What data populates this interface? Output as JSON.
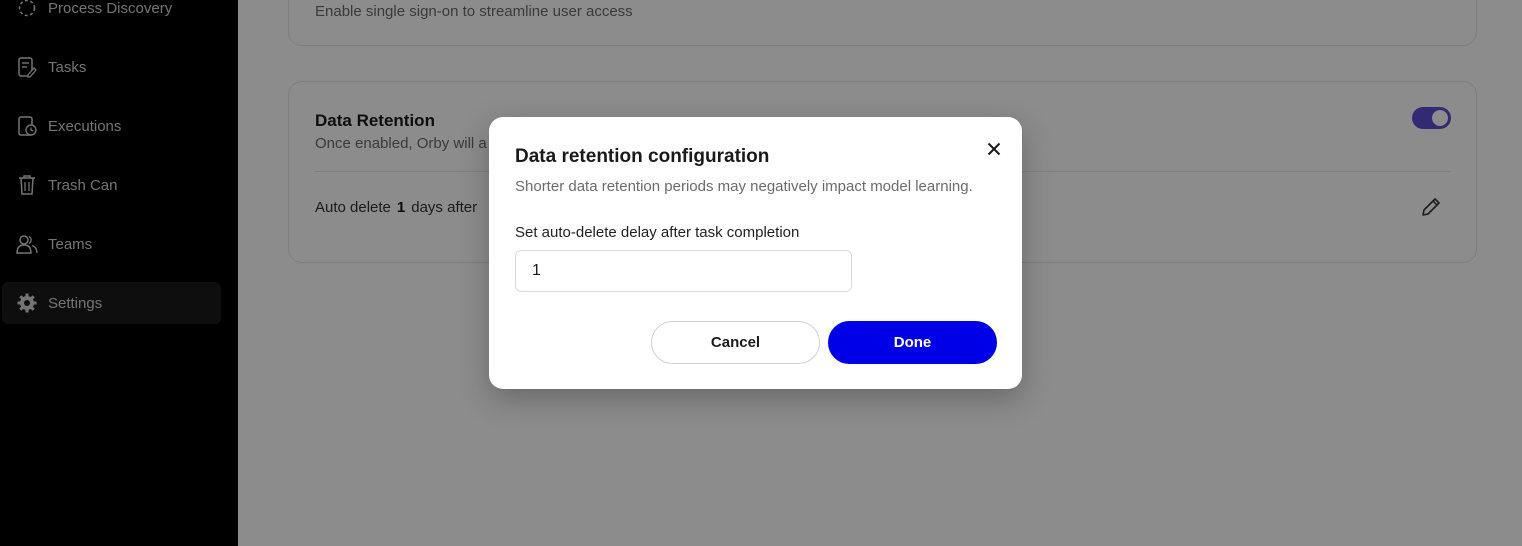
{
  "sidebar": {
    "items": [
      {
        "label": "Process Discovery",
        "icon": "process-discovery-icon"
      },
      {
        "label": "Tasks",
        "icon": "tasks-icon"
      },
      {
        "label": "Executions",
        "icon": "executions-icon"
      },
      {
        "label": "Trash Can",
        "icon": "trash-icon"
      },
      {
        "label": "Teams",
        "icon": "teams-icon"
      },
      {
        "label": "Settings",
        "icon": "gear-icon",
        "active": true
      }
    ]
  },
  "main": {
    "sso_card": {
      "description": "Enable single sign-on to streamline user access"
    },
    "data_retention_card": {
      "title": "Data Retention",
      "description": "Once enabled, Orby will a",
      "toggle_on": true,
      "auto_delete_prefix": "Auto delete",
      "auto_delete_value": "1",
      "auto_delete_suffix": "days after"
    }
  },
  "modal": {
    "title": "Data retention configuration",
    "subtitle": "Shorter data retention periods may negatively impact model learning.",
    "field_label": "Set auto-delete delay after task completion",
    "field_value": "1",
    "cancel_label": "Cancel",
    "done_label": "Done"
  },
  "colors": {
    "accent": "#0000e6",
    "toggle": "#5b4fd1",
    "sidebar_bg": "#000000"
  }
}
